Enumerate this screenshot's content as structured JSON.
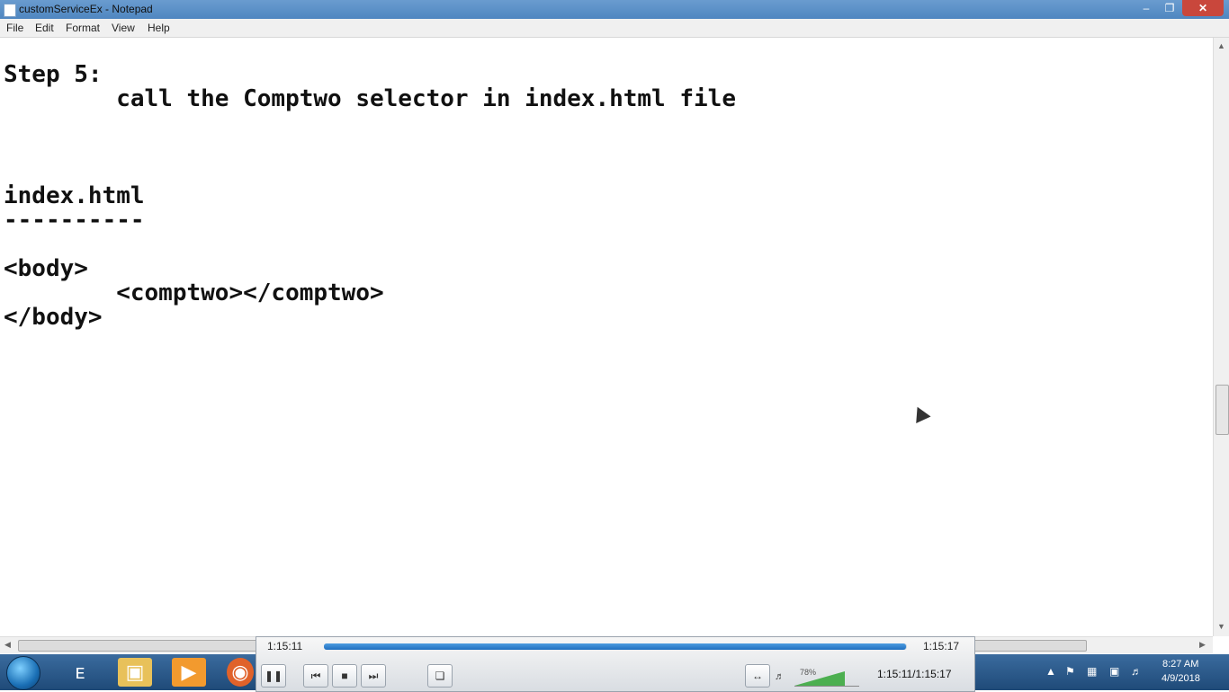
{
  "window": {
    "title": "customServiceEx - Notepad",
    "min_icon": "minimize-icon",
    "max_icon": "maximize-icon",
    "close_icon": "close-icon"
  },
  "menu": [
    "File",
    "Edit",
    "Format",
    "View",
    "Help"
  ],
  "editor": {
    "lines": [
      "Step 5:",
      "        call the Comptwo selector in index.html file",
      "",
      "",
      "",
      "index.html",
      "----------",
      "",
      "<body>",
      "        <comptwo></comptwo>",
      "</body>"
    ]
  },
  "player": {
    "current_time": "1:15:11",
    "total_time": "1:15:17",
    "progress_fraction": 0.998,
    "volume": "78%",
    "volume_fraction": 0.78,
    "timecode": "1:15:11/1:15:17"
  },
  "taskbar": {
    "clock_time": "8:27 AM",
    "clock_date": "4/9/2018",
    "apps": [
      "internet-explorer-icon",
      "file-explorer-icon",
      "media-player-icon",
      "firefox-icon"
    ]
  },
  "colors": {
    "titlebar": "#5a8fc6",
    "close_button": "#c9473c",
    "taskbar": "#2a5a8c",
    "seek_fill": "#2f80d0"
  }
}
